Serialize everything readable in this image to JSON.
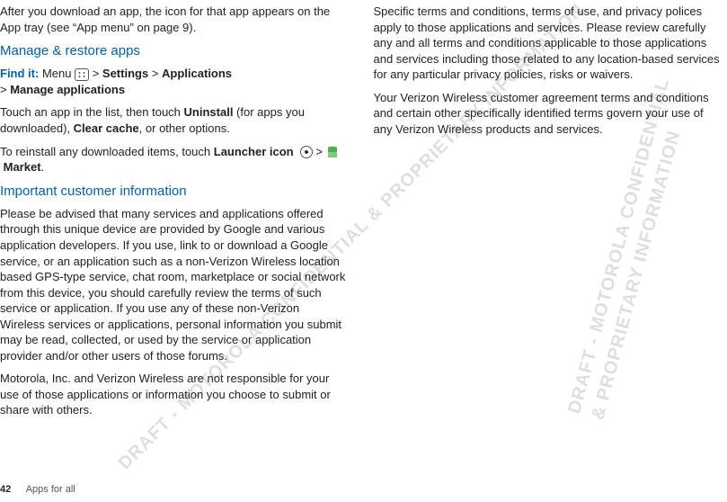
{
  "watermarks": {
    "left": "DRAFT - MOTOROLA CONFIDENTIAL & PROPRIETARY INFORMATION",
    "right1": "DRAFT - MOTOROLA CONFIDENTIAL",
    "right2": "& PROPRIETARY INFORMATION"
  },
  "left_col": {
    "intro": "After you download an app, the icon for that app appears on the App tray (see “App menu” on page 9).",
    "heading1": "Manage & restore apps",
    "findit_label": "Find it:",
    "findit_menu_word": " Menu ",
    "findit_after_menu": " > ",
    "findit_settings": "Settings",
    "findit_sep2": " > ",
    "findit_apps": "Applications",
    "findit_line2_sep": "> ",
    "findit_manage": "Manage applications",
    "para2a": "Touch an app in the list, then touch ",
    "para2_uninstall": "Uninstall",
    "para2b": " (for apps you downloaded), ",
    "para2_clear": "Clear cache",
    "para2c": ", or other options.",
    "para3a": "To reinstall any downloaded items, touch ",
    "para3_launcher": "Launcher icon",
    "para3_sep1": "  >  ",
    "para3_market": "Market",
    "para3_end": ".",
    "heading2": "Important customer information",
    "para4": "Please be advised that many services and applications offered through this unique device are provided by Google and various application developers. If you use, link to or download a Google service, or an application such as a non-Verizon Wireless location based GPS-type service, chat room, marketplace or social network from this device, you should carefully review the terms of such service or application. If you use any of these non-Verizon Wireless services or applications, personal information you submit may be read, collected, or used by the service or application provider and/or other users of those forums.",
    "para5": "Motorola, Inc. and Verizon Wireless are not responsible for your use of those applications or information you choose to submit or share with others."
  },
  "right_col": {
    "para1": "Specific terms and conditions, terms of use, and privacy polices apply to those applications and services. Please review carefully any and all terms and conditions applicable to those applications and services including those related to any location-based services for any particular privacy policies, risks or waivers.",
    "para2": "Your Verizon Wireless customer agreement terms and conditions and certain other specifically identified terms govern your use of any Verizon Wireless products and services."
  },
  "footer": {
    "page": "42",
    "title": "Apps for all"
  }
}
